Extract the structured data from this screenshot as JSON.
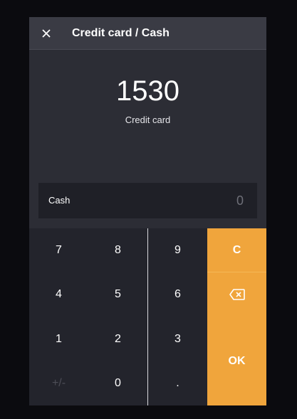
{
  "header": {
    "title": "Credit card / Cash",
    "close_icon": "close-icon"
  },
  "summary": {
    "amount": "1530",
    "label": "Credit card"
  },
  "cash_field": {
    "label": "Cash",
    "value": "0"
  },
  "keypad": {
    "keys": [
      "7",
      "8",
      "9",
      "4",
      "5",
      "6",
      "1",
      "2",
      "3",
      "+/-",
      "0",
      "."
    ],
    "clear_label": "C",
    "backspace_icon": "backspace-icon",
    "ok_label": "OK"
  },
  "colors": {
    "accent": "#f0a53c",
    "background": "#2c2d35",
    "header": "#3a3b44",
    "keypad": "#23242c"
  }
}
